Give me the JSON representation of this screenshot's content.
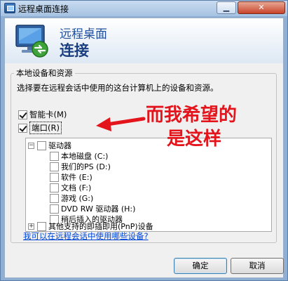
{
  "window": {
    "title": "远程桌面连接",
    "close_glyph": "✕",
    "min_glyph": "▁"
  },
  "header": {
    "line1": "远程桌面",
    "line2": "连接"
  },
  "group": {
    "legend": "本地设备和资源",
    "description": "选择要在远程会话中使用的这台计算机上的设备和资源。",
    "smartcard": {
      "label": "智能卡(M)",
      "checked": true
    },
    "ports": {
      "label": "端口(R)",
      "checked": true
    }
  },
  "tree": {
    "drives": {
      "expander": "−",
      "label": "驱动器"
    },
    "drive_items": [
      "本地磁盘 (C:)",
      "我们的PS (D:)",
      "软件 (E:)",
      "文档 (F:)",
      "游戏 (G:)",
      "DVD RW 驱动器 (H:)",
      "稍后插入的驱动器"
    ],
    "other": {
      "expander": "+",
      "label": "其他支持的即插即用(PnP)设备"
    }
  },
  "link": "我可以在远程会话中使用哪些设备?",
  "buttons": {
    "ok": "确定",
    "cancel": "取消"
  },
  "annotation": {
    "line1": "而我希望的",
    "line2": "是这样",
    "color": "#e3141b"
  }
}
